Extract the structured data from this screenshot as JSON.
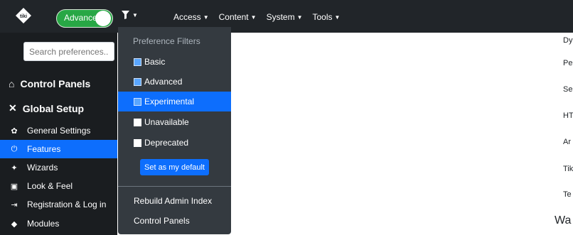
{
  "topbar": {
    "logo_text": "tiki",
    "mode_toggle_label": "Advanced",
    "filter_icon": "funnel-icon",
    "nav": [
      {
        "label": "Access"
      },
      {
        "label": "Content"
      },
      {
        "label": "System"
      },
      {
        "label": "Tools"
      }
    ]
  },
  "sidebar": {
    "search_placeholder": "Search preferences...",
    "control_panels": "Control Panels",
    "global_setup": "Global Setup",
    "items": [
      {
        "label": "General Settings",
        "icon": "gear-icon",
        "glyph": "✿"
      },
      {
        "label": "Features",
        "icon": "power-icon",
        "glyph": "⏻"
      },
      {
        "label": "Wizards",
        "icon": "magic-wand-icon",
        "glyph": "✦"
      },
      {
        "label": "Look & Feel",
        "icon": "image-icon",
        "glyph": "▣"
      },
      {
        "label": "Registration & Log in",
        "icon": "sign-in-icon",
        "glyph": "⇥"
      },
      {
        "label": "Modules",
        "icon": "cubes-icon",
        "glyph": "◆"
      }
    ]
  },
  "dropdown": {
    "header": "Preference Filters",
    "filters": [
      {
        "label": "Basic",
        "checked": true
      },
      {
        "label": "Advanced",
        "checked": true
      },
      {
        "label": "Experimental",
        "checked": true
      },
      {
        "label": "Unavailable",
        "checked": false
      },
      {
        "label": "Deprecated",
        "checked": false
      }
    ],
    "default_button": "Set as my default",
    "rebuild": "Rebuild Admin Index",
    "control_panels": "Control Panels"
  },
  "main": {
    "rows": [
      "Dy",
      "Pe",
      "Se",
      "HT",
      "Ar",
      "Tik",
      "Te"
    ],
    "bottom_heading": "Wa"
  }
}
